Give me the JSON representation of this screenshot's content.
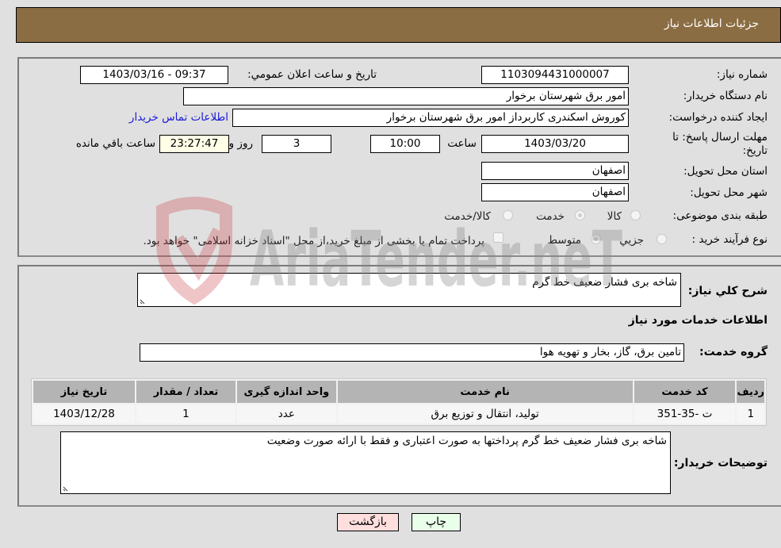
{
  "header": {
    "title": "جزئیات اطلاعات نیاز"
  },
  "details": {
    "need_number": {
      "label": "شماره نیاز:",
      "value": "1103094431000007"
    },
    "announce_datetime": {
      "label": "تاریخ و ساعت اعلان عمومي:",
      "value": "1403/03/16 - 09:37"
    },
    "buyer_org": {
      "label": "نام دستگاه خريدار:",
      "value": "امور برق شهرستان برخوار"
    },
    "creator": {
      "label": "ایجاد کننده درخواست:",
      "value": "کوروش  اسکندری  کاربرداز امور برق شهرستان برخوار"
    },
    "buyer_contact_link": "اطلاعات تماس خريدار",
    "deadline": {
      "label_line1": "مهلت ارسال پاسخ: تا",
      "label_line2": "تاریخ:",
      "date": "1403/03/20",
      "time_label": "ساعت",
      "time": "10:00",
      "days": "3",
      "days_label": "روز و",
      "remaining": "23:27:47",
      "remaining_label": "ساعت باقي مانده"
    },
    "province": {
      "label": "استان محل تحویل:",
      "value": "اصفهان"
    },
    "city": {
      "label": "شهر محل تحویل:",
      "value": "اصفهان"
    },
    "category": {
      "label": "طبقه بندی موضوعی:",
      "options": [
        "کالا",
        "خدمت",
        "کالا/خدمت"
      ],
      "selected": "خدمت"
    },
    "purchase_type": {
      "label": "نوع فرآیند خرید :",
      "options": [
        "جزيي",
        "متوسط"
      ],
      "selected": "متوسط",
      "treasury_checkbox_label": "پرداخت تمام یا بخشی از مبلغ خرید،از محل \"اسناد خزانه اسلامی\" خواهد بود.",
      "treasury_checked": false
    }
  },
  "summary": {
    "general_desc_label": "شرح کلي نياز:",
    "general_desc": "شاخه بری فشار ضعیف خط گرم",
    "services_heading": "اطلاعات خدمات مورد نياز",
    "service_group_label": "گروه خدمت:",
    "service_group": "تامین برق، گاز، بخار و تهویه هوا"
  },
  "table": {
    "headers": [
      "رديف",
      "کد خدمت",
      "نام خدمت",
      "واحد اندازه گيری",
      "تعداد / مقدار",
      "تاريخ نياز"
    ],
    "rows": [
      [
        "1",
        "ت -35-351",
        "تولید، انتقال و توزیع برق",
        "عدد",
        "1",
        "1403/12/28"
      ]
    ]
  },
  "buyer_notes": {
    "label": "توضيحات خريدار:",
    "value": "شاخه بری فشار ضعیف خط گرم پرداختها به صورت اعتباری و فقط با ارائه صورت وضعیت"
  },
  "buttons": {
    "print": "چاپ",
    "back": "بازگشت"
  },
  "watermark": {
    "text": "AriaTender.neT"
  }
}
